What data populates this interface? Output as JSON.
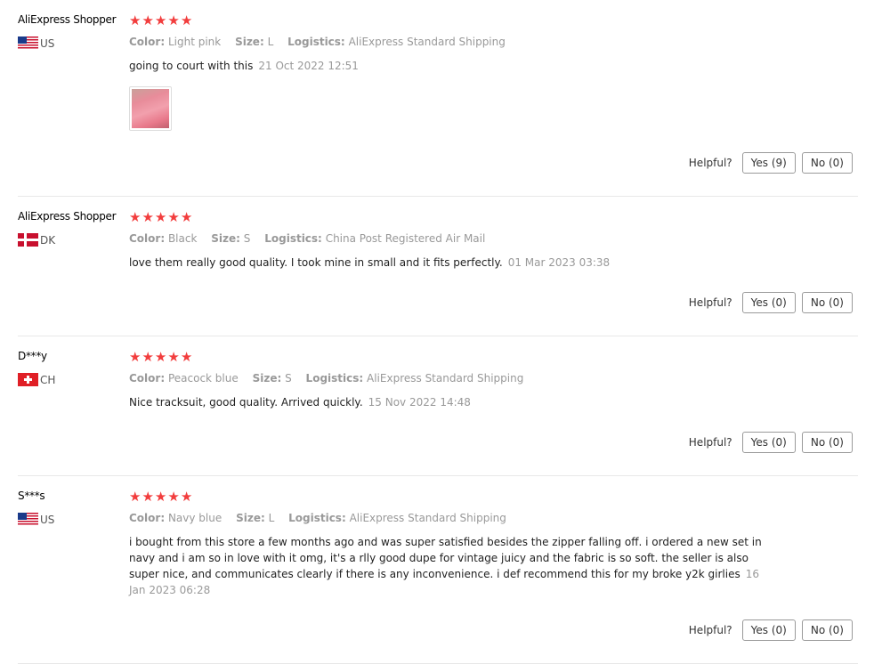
{
  "labels": {
    "color": "Color:",
    "size": "Size:",
    "logistics": "Logistics:",
    "helpful": "Helpful?"
  },
  "colors": {
    "star": "#f23d3d",
    "divider": "#e8e8e8"
  },
  "reviews": [
    {
      "user": "AliExpress Shopper",
      "country": "US",
      "flag_icon": "us-flag-icon",
      "stars": 5,
      "color": "Light pink",
      "size": "L",
      "logistics": "AliExpress Standard Shipping",
      "text": "going to court with this",
      "date": "21 Oct 2022 12:51",
      "yes": "Yes (9)",
      "no": "No (0)"
    },
    {
      "user": "AliExpress Shopper",
      "country": "DK",
      "flag_icon": "dk-flag-icon",
      "stars": 5,
      "color": "Black",
      "size": "S",
      "logistics": "China Post Registered Air Mail",
      "text": "love them really good quality. I took mine in small and it fits perfectly.",
      "date": "01 Mar 2023 03:38",
      "yes": "Yes (0)",
      "no": "No (0)"
    },
    {
      "user": "D***y",
      "country": "CH",
      "flag_icon": "ch-flag-icon",
      "stars": 5,
      "color": "Peacock blue",
      "size": "S",
      "logistics": "AliExpress Standard Shipping",
      "text": "Nice tracksuit, good quality. Arrived quickly.",
      "date": "15 Nov 2022 14:48",
      "yes": "Yes (0)",
      "no": "No (0)"
    },
    {
      "user": "S***s",
      "country": "US",
      "flag_icon": "us-flag-icon",
      "stars": 5,
      "color": "Navy blue",
      "size": "L",
      "logistics": "AliExpress Standard Shipping",
      "text": "i bought from this store a few months ago and was super satisfied besides the zipper falling off. i ordered a new set in navy and i am so in love with it omg, it's a rlly good dupe for vintage juicy and the fabric is so soft. the seller is also super nice, and communicates clearly if there is any inconvenience. i def recommend this for my broke y2k girlies",
      "date": "16 Jan 2023 06:28",
      "yes": "Yes (0)",
      "no": "No (0)"
    }
  ]
}
